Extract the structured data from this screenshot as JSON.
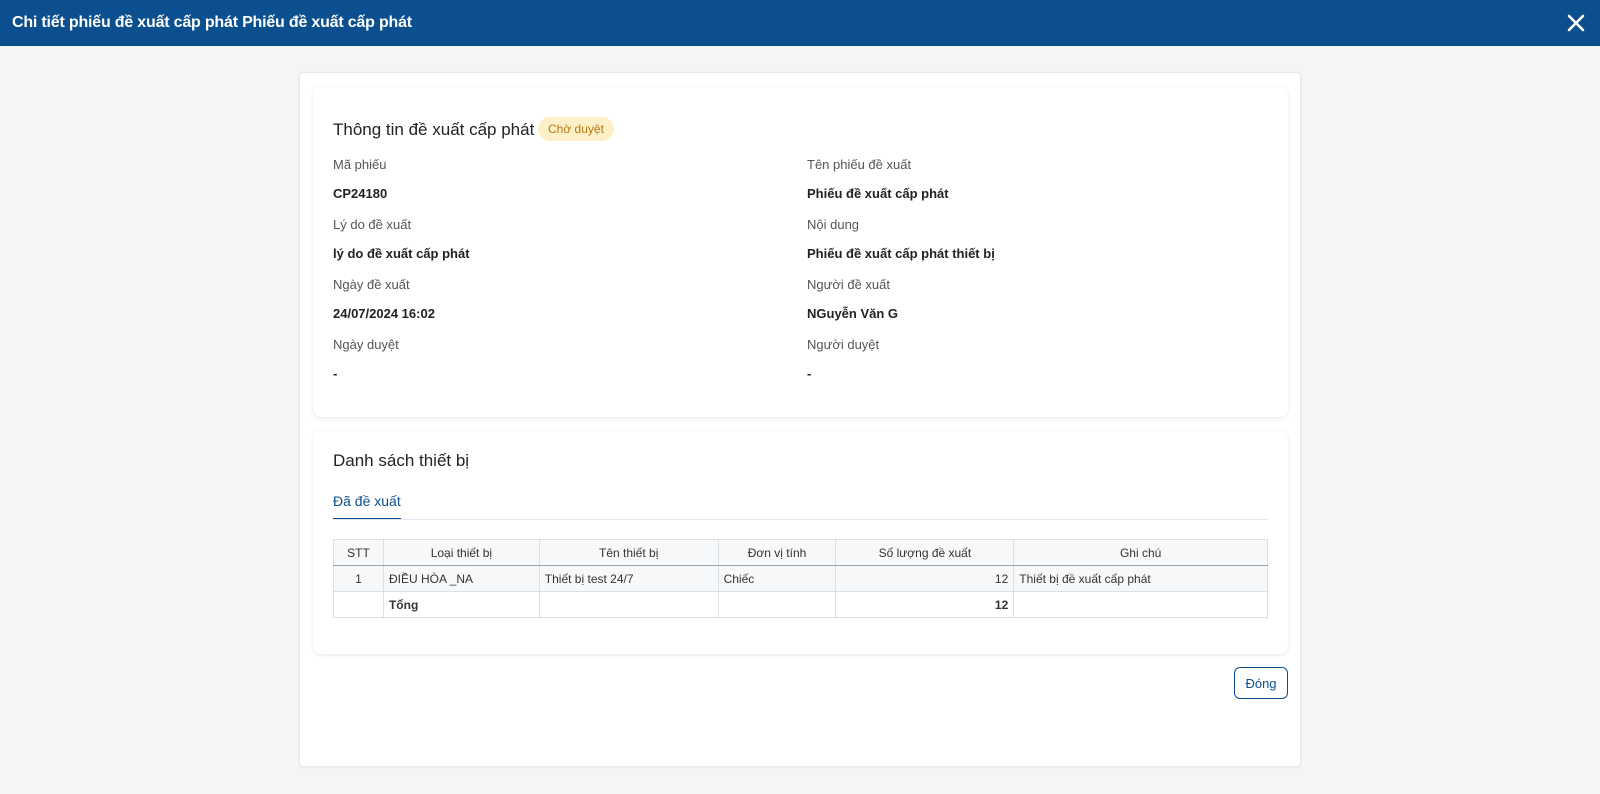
{
  "header": {
    "title": "Chi tiết phiếu đề xuất cấp phát Phiếu đề xuất cấp phát",
    "close_icon": "close-icon"
  },
  "info": {
    "title": "Thông tin đề xuất cấp phát",
    "status": "Chờ duyệt",
    "fields": {
      "ma_phieu_label": "Mã phiếu",
      "ma_phieu_value": "CP24180",
      "ten_phieu_label": "Tên phiếu đề xuất",
      "ten_phieu_value": "Phiếu đề xuất cấp phát",
      "ly_do_label": "Lý do đề xuất",
      "ly_do_value": "lý do đề xuất cấp phát",
      "noi_dung_label": "Nội dung",
      "noi_dung_value": "Phiếu đề xuất cấp phát thiết bị",
      "ngay_de_xuat_label": "Ngày đề xuất",
      "ngay_de_xuat_value": "24/07/2024 16:02",
      "nguoi_de_xuat_label": "Người đề xuất",
      "nguoi_de_xuat_value": "NGuyễn Văn G",
      "ngay_duyet_label": "Ngày duyệt",
      "ngay_duyet_value": "-",
      "nguoi_duyet_label": "Người duyệt",
      "nguoi_duyet_value": "-"
    }
  },
  "devices": {
    "title": "Danh sách thiết bị",
    "tab": "Đã đề xuất",
    "columns": [
      "STT",
      "Loại thiết bị",
      "Tên thiết bị",
      "Đơn vị tính",
      "Số lượng đề xuất",
      "Ghi chú"
    ],
    "rows": [
      [
        "1",
        "ĐIỀU HÒA _NA",
        "Thiết bị test 24/7",
        "Chiếc",
        "12",
        "Thiết bị đề xuất cấp phát"
      ]
    ],
    "total_label": "Tổng",
    "total_value": "12"
  },
  "footer": {
    "close_label": "Đóng"
  },
  "colors": {
    "header_bg": "#0b4f8e",
    "badge_bg": "#fdf0c8",
    "badge_text": "#b9770e"
  }
}
